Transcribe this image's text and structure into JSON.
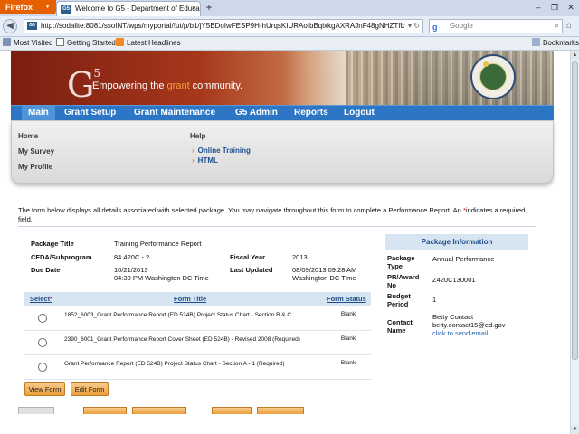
{
  "browser": {
    "firefox_label": "Firefox",
    "tab_title": "Welcome to G5 - Department of Educati...",
    "url": "http://sodalite:8081/ssoINT/wps/myportal/!ut/p/b1/jY5BDoIwFESP9H-hUrqsKIURAoIbBqixkgAXRAJnF48gNHZTfL",
    "search_placeholder": "Google",
    "bookmarks": [
      "Most Visited",
      "Getting Started",
      "Latest Headlines"
    ],
    "bookmarks_right": "Bookmarks"
  },
  "banner": {
    "tagline_pre": "Empowering the ",
    "tagline_accent": "grant",
    "tagline_post": " community."
  },
  "main_menu": [
    "Main",
    "Grant Setup",
    "Grant Maintenance",
    "G5 Admin",
    "Reports",
    "Logout"
  ],
  "sub_menu": {
    "home": "Home",
    "my_survey": "My Survey",
    "my_profile": "My Profile",
    "help": "Help",
    "help_links": [
      "Online Training",
      "HTML"
    ]
  },
  "intro": {
    "text_a": "The form below displays all details associated with selected package. You may navigate throughout this form to complete a Performance Report.  An ",
    "star": "*",
    "text_b": "indicates a required field."
  },
  "package": {
    "title_label": "Package Title",
    "title_value": "Training Performance Report",
    "cfda_label": "CFDA/Subprogram",
    "cfda_value": "84.420C - 2",
    "fiscal_label": "Fiscal Year",
    "fiscal_value": "2013",
    "due_label": "Due Date",
    "due_value_1": "10/21/2013",
    "due_value_2": "04:30 PM Washington DC Time",
    "updated_label": "Last Updated",
    "updated_value_1": "08/09/2013 09:28 AM",
    "updated_value_2": "Washington DC Time"
  },
  "info": {
    "heading": "Package Information",
    "type_label_1": "Package",
    "type_label_2": "Type",
    "type_value": "Annual Performance",
    "pr_label_1": "PR/Award",
    "pr_label_2": "No",
    "pr_value": "Z420C130001",
    "budget_label_1": "Budget",
    "budget_label_2": "Period",
    "budget_value": "1",
    "contact_label_1": "Contact",
    "contact_label_2": "Name",
    "contact_name": "Betty Contact",
    "contact_email": "betty.contact15@ed.gov",
    "contact_link": "click to send email"
  },
  "forms": {
    "col_select": "Select",
    "col_select_star": "*",
    "col_title": "Form Title",
    "col_status": "Form Status",
    "rows": [
      {
        "title": "1852_6003_Grant Performance Report (ED 524B) Project Status Chart - Section B & C",
        "status": "Blank"
      },
      {
        "title": "2390_6001_Grant Performance Report Cover Sheet (ED 524B) - Revised 2008 (Required)",
        "status": "Blank"
      },
      {
        "title": "Grant Performance Report (ED 524B) Project Status Chart - Section A - 1 (Required)",
        "status": "Blank"
      }
    ]
  },
  "buttons": {
    "view": "View Form",
    "edit": "Edit Form"
  }
}
